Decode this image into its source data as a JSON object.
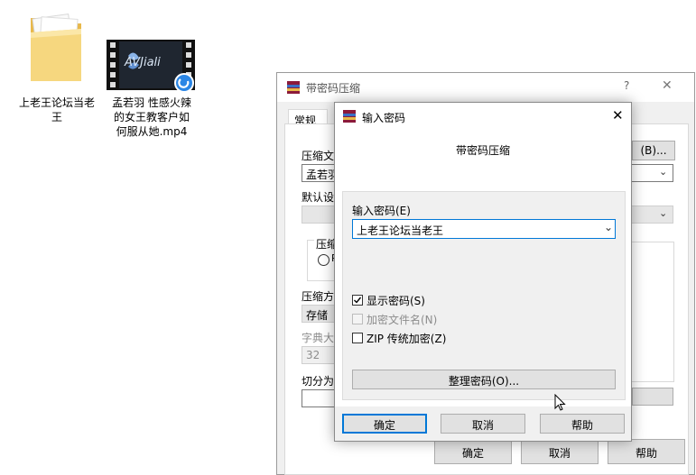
{
  "desktop": {
    "folder_label_line1": "上老王论坛当老",
    "folder_label_line2": "王",
    "video_thumb_text": "AVJiali",
    "video_label_line1": "孟若羽 性感火辣",
    "video_label_line2": "的女王教客户如",
    "video_label_line3": "何服从她.mp4"
  },
  "back_dialog": {
    "title": "带密码压缩",
    "help_char": "?",
    "close_char": "✕",
    "tab_general": "常规",
    "label_archive": "压缩文",
    "archive_value": "孟若羽",
    "browse_button": "(B)...",
    "label_default": "默认设",
    "label_format": "压缩",
    "radio_label": "R",
    "label_method": "压缩方",
    "method_value": "存储",
    "label_dict": "字典大",
    "dict_value": "32",
    "label_split": "切分为",
    "ok_button": "确定",
    "cancel_button": "取消",
    "help_button": "帮助"
  },
  "password_dialog": {
    "title": "输入密码",
    "close_char": "✕",
    "subtitle": "带密码压缩",
    "password_label": "输入密码(E)",
    "password_value": "上老王论坛当老王",
    "show_password": "显示密码(S)",
    "encrypt_filenames": "加密文件名(N)",
    "zip_legacy": "ZIP 传统加密(Z)",
    "organize_button": "整理密码(O)...",
    "ok_button": "确定",
    "cancel_button": "取消",
    "help_button": "帮助"
  },
  "colors": {
    "dialog_bg": "#f0f0f0",
    "focus_border": "#0078d7",
    "button_bg": "#e1e1e1",
    "disabled_text": "#8d8d8d"
  }
}
